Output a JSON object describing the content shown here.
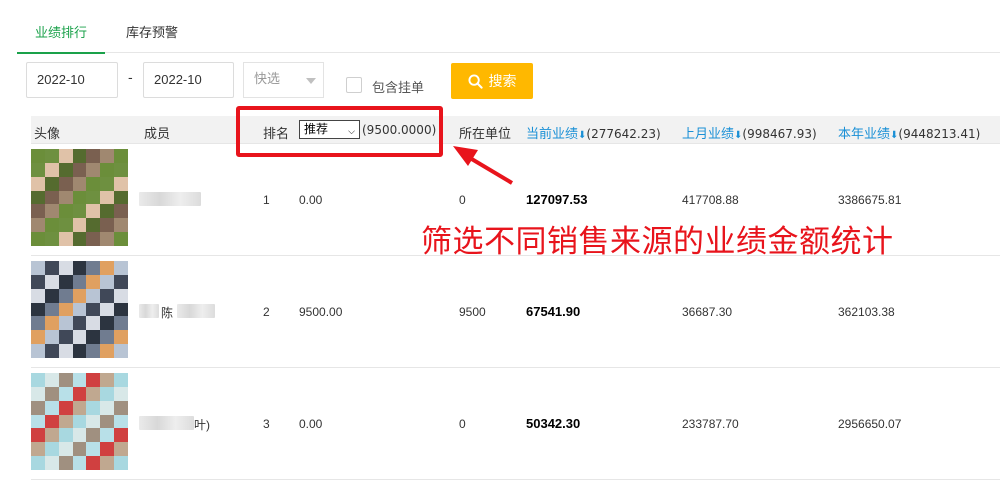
{
  "tabs": [
    {
      "label": "业绩排行",
      "active": true
    },
    {
      "label": "库存预警",
      "active": false
    }
  ],
  "filters": {
    "date_from": "2022-10",
    "date_separator": "-",
    "date_to": "2022-10",
    "quick_select_placeholder": "快选",
    "include_pending_label": "包含挂单",
    "search_label": "搜索"
  },
  "table": {
    "headers": {
      "avatar": "头像",
      "member": "成员",
      "rank": "排名",
      "rank_source_selected": "推荐",
      "rank_source_total": "(9500.0000)",
      "unit": "所在单位",
      "current_perf": "当前业绩",
      "current_total": "(277642.23)",
      "last_month_perf": "上月业绩",
      "last_month_total": "(998467.93)",
      "year_perf": "本年业绩",
      "year_total": "(9448213.41)"
    },
    "rows": [
      {
        "name": "",
        "rank": "1",
        "source_amount": "0.00",
        "unit": "0",
        "current": "127097.53",
        "last_month": "417708.88",
        "year": "3386675.81"
      },
      {
        "name": "陈",
        "rank": "2",
        "source_amount": "9500.00",
        "unit": "9500",
        "current": "67541.90",
        "last_month": "36687.30",
        "year": "362103.38"
      },
      {
        "name": "叶)",
        "rank": "3",
        "source_amount": "0.00",
        "unit": "0",
        "current": "50342.30",
        "last_month": "233787.70",
        "year": "2956650.07"
      }
    ]
  },
  "annotation": {
    "text": "筛选不同销售来源的业绩金额统计",
    "color": "#e8141c"
  },
  "colors": {
    "accent_green": "#1aa14a",
    "search_button": "#ffb800",
    "link_blue": "#1a90d6"
  }
}
